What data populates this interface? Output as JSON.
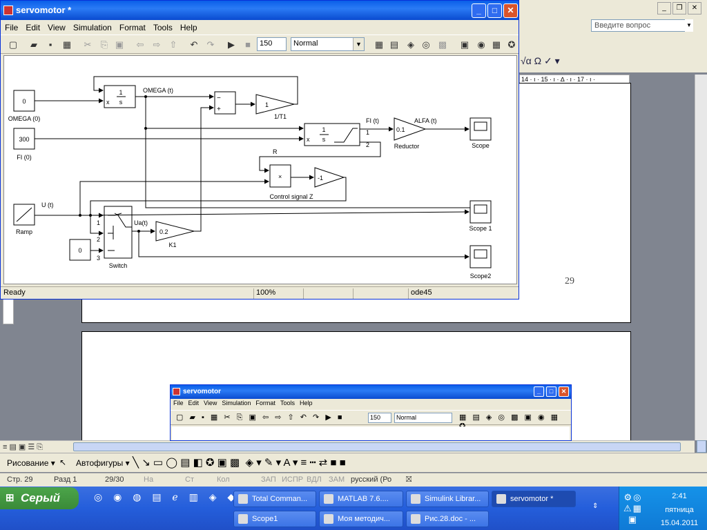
{
  "word": {
    "help_placeholder": "Введите вопрос",
    "ruler": "14 · ı · 15 · ı · ∆ · ı · 17 · ı ·",
    "page_number": "29",
    "draw_menu": "Рисование ▾",
    "autoshapes": "Автофигуры ▾",
    "status": {
      "page": "Стр. 29",
      "section": "Разд 1",
      "pages": "29/30",
      "at": "На",
      "line": "Ст",
      "col": "Кол",
      "rec": "ЗАП",
      "trk": "ИСПР",
      "ext": "ВДЛ",
      "ovr": "ЗАМ",
      "lang": "русский (Ро"
    }
  },
  "simulink": {
    "title": "servomotor *",
    "menu": [
      "File",
      "Edit",
      "View",
      "Simulation",
      "Format",
      "Tools",
      "Help"
    ],
    "stop_time": "150",
    "sim_mode": "Normal",
    "status": {
      "ready": "Ready",
      "zoom": "100%",
      "solver": "ode45"
    },
    "blocks": {
      "omega0_val": "0",
      "omega0_label": "OMEGA (0)",
      "fi0_val": "300",
      "fi0_label": "FI (0)",
      "ramp_label": "Ramp",
      "const0_val": "0",
      "switch_label": "Switch",
      "int1_num": "1",
      "int1_den": "s",
      "int1_x0": "x",
      "gain1_val": "1",
      "gain1_label": "1/T1",
      "reductor_val": "0.1",
      "reductor_label": "Reductor",
      "gain_k1_val": "0.2",
      "gain_k1_label": "K1",
      "gain_neg_val": "-1",
      "control_label": "Control signal Z",
      "scope_label": "Scope",
      "scope1_label": "Scope 1",
      "scope2_label": "Scope2"
    },
    "signals": {
      "omega": "OMEGA (t)",
      "fi": "FI (t)",
      "alfa": "ALFA (t)",
      "u": "U (t)",
      "ua": "Ua(t)",
      "r": "R",
      "port1": "1",
      "port2": "2",
      "sw1": "1",
      "sw2": "2",
      "sw3": "3"
    }
  },
  "simulink2": {
    "title": "servomotor",
    "menu": [
      "File",
      "Edit",
      "View",
      "Simulation",
      "Format",
      "Tools",
      "Help"
    ],
    "stop_time": "150",
    "sim_mode": "Normal"
  },
  "taskbar": {
    "start": "Серый",
    "buttons": [
      "Total Comman...",
      "MATLAB 7.6....",
      "Simulink Librar...",
      "servomotor *",
      "Scope1",
      "Моя методич...",
      "Рис.28.doc - ..."
    ],
    "time": "2:41",
    "day": "пятница",
    "date": "15.04.2011"
  }
}
